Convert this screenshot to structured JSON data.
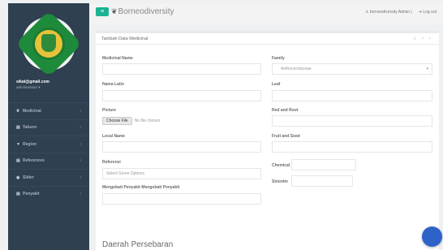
{
  "topbar": {
    "brand": "Borneodiversity",
    "user": "borneodiversity Admin |",
    "logout": "Log out"
  },
  "sidebar": {
    "email": "sikat@gmail.com",
    "role": "administrator ▾",
    "items": [
      {
        "icon": "leaf-icon",
        "glyph": "❦",
        "label": "Medicinal",
        "arrow": "‹"
      },
      {
        "icon": "taxon-icon",
        "glyph": "▤",
        "label": "Takson",
        "arrow": "‹"
      },
      {
        "icon": "map-marker-icon",
        "glyph": "▼",
        "label": "Region",
        "arrow": "‹"
      },
      {
        "icon": "book-icon",
        "glyph": "▤",
        "label": "References",
        "arrow": "‹"
      },
      {
        "icon": "slider-icon",
        "glyph": "◉",
        "label": "Slider",
        "arrow": "‹"
      },
      {
        "icon": "disease-icon",
        "glyph": "▤",
        "label": "Penyakit",
        "arrow": "‹"
      }
    ]
  },
  "panel": {
    "title": "Tambah Data Medicinal",
    "tools": "∧ ↗ ×"
  },
  "form": {
    "medicinal_name_label": "Medicinal Name",
    "family_label": "Family",
    "family_value": "Anthocerotaceae",
    "family_arrow": "▾",
    "nama_latin_label": "Nama Latin",
    "leaf_label": "Leaf",
    "picture_label": "Picture",
    "choose_file": "Choose File",
    "no_file": "No file chosen",
    "red_root_label": "Red and Root",
    "local_name_label": "Local Name",
    "fruit_seed_label": "Fruit and Seed",
    "referensi_label": "Referensi",
    "referensi_placeholder": "Select Some Options",
    "chemical_label": "Chemical",
    "sinonim_label": "Sinonim",
    "mengobati_label": "Mengobati Penyakit Mengobati Penyakit"
  },
  "section": {
    "title": "Daerah Persebaran"
  }
}
